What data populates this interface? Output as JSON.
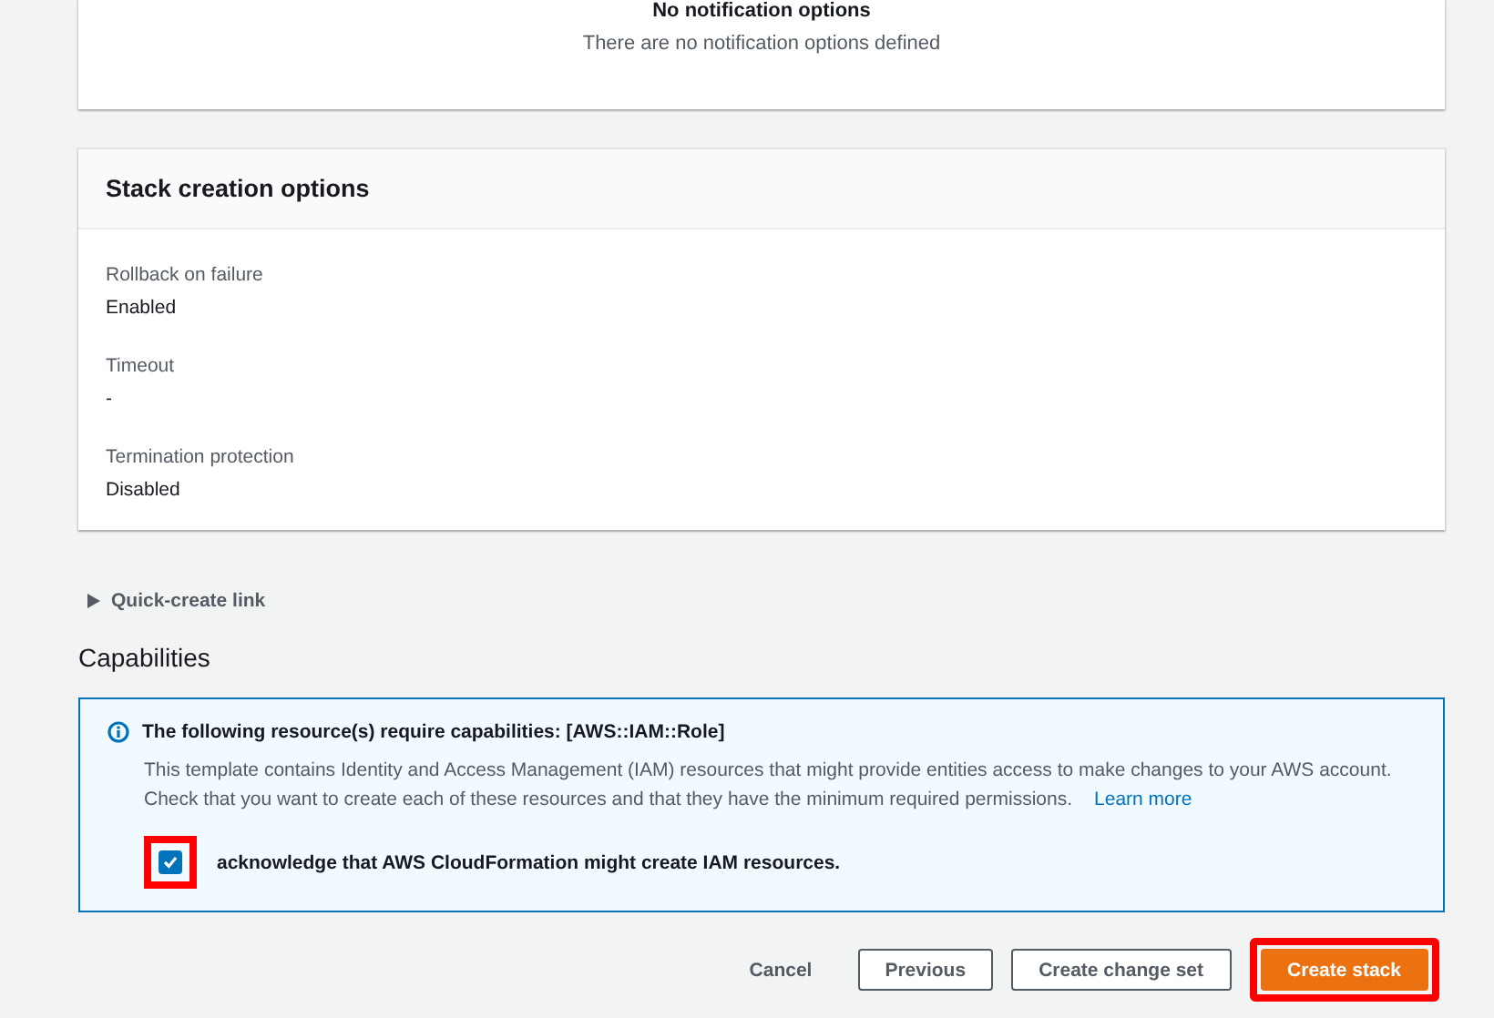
{
  "notification_panel": {
    "heading": "No notification options",
    "message": "There are no notification options defined"
  },
  "stack_options": {
    "title": "Stack creation options",
    "fields": [
      {
        "label": "Rollback on failure",
        "value": "Enabled"
      },
      {
        "label": "Timeout",
        "value": "-"
      },
      {
        "label": "Termination protection",
        "value": "Disabled"
      }
    ]
  },
  "quick_create": {
    "label": "Quick-create link",
    "expanded": false
  },
  "capabilities": {
    "title": "Capabilities",
    "alert_title": "The following resource(s) require capabilities: [AWS::IAM::Role]",
    "alert_text": "This template contains Identity and Access Management (IAM) resources that might provide entities access to make changes to your AWS account. Check that you want to create each of these resources and that they have the minimum required permissions.",
    "link": "Learn more",
    "acknowledge": {
      "label": "acknowledge that AWS CloudFormation might create IAM resources.",
      "checked": true,
      "highlighted": true
    }
  },
  "actions": [
    {
      "label": "Cancel",
      "kind": "link",
      "highlighted": false
    },
    {
      "label": "Previous",
      "kind": "outline",
      "highlighted": false
    },
    {
      "label": "Create change set",
      "kind": "outline",
      "highlighted": false
    },
    {
      "label": "Create stack",
      "kind": "primary",
      "highlighted": true
    }
  ]
}
